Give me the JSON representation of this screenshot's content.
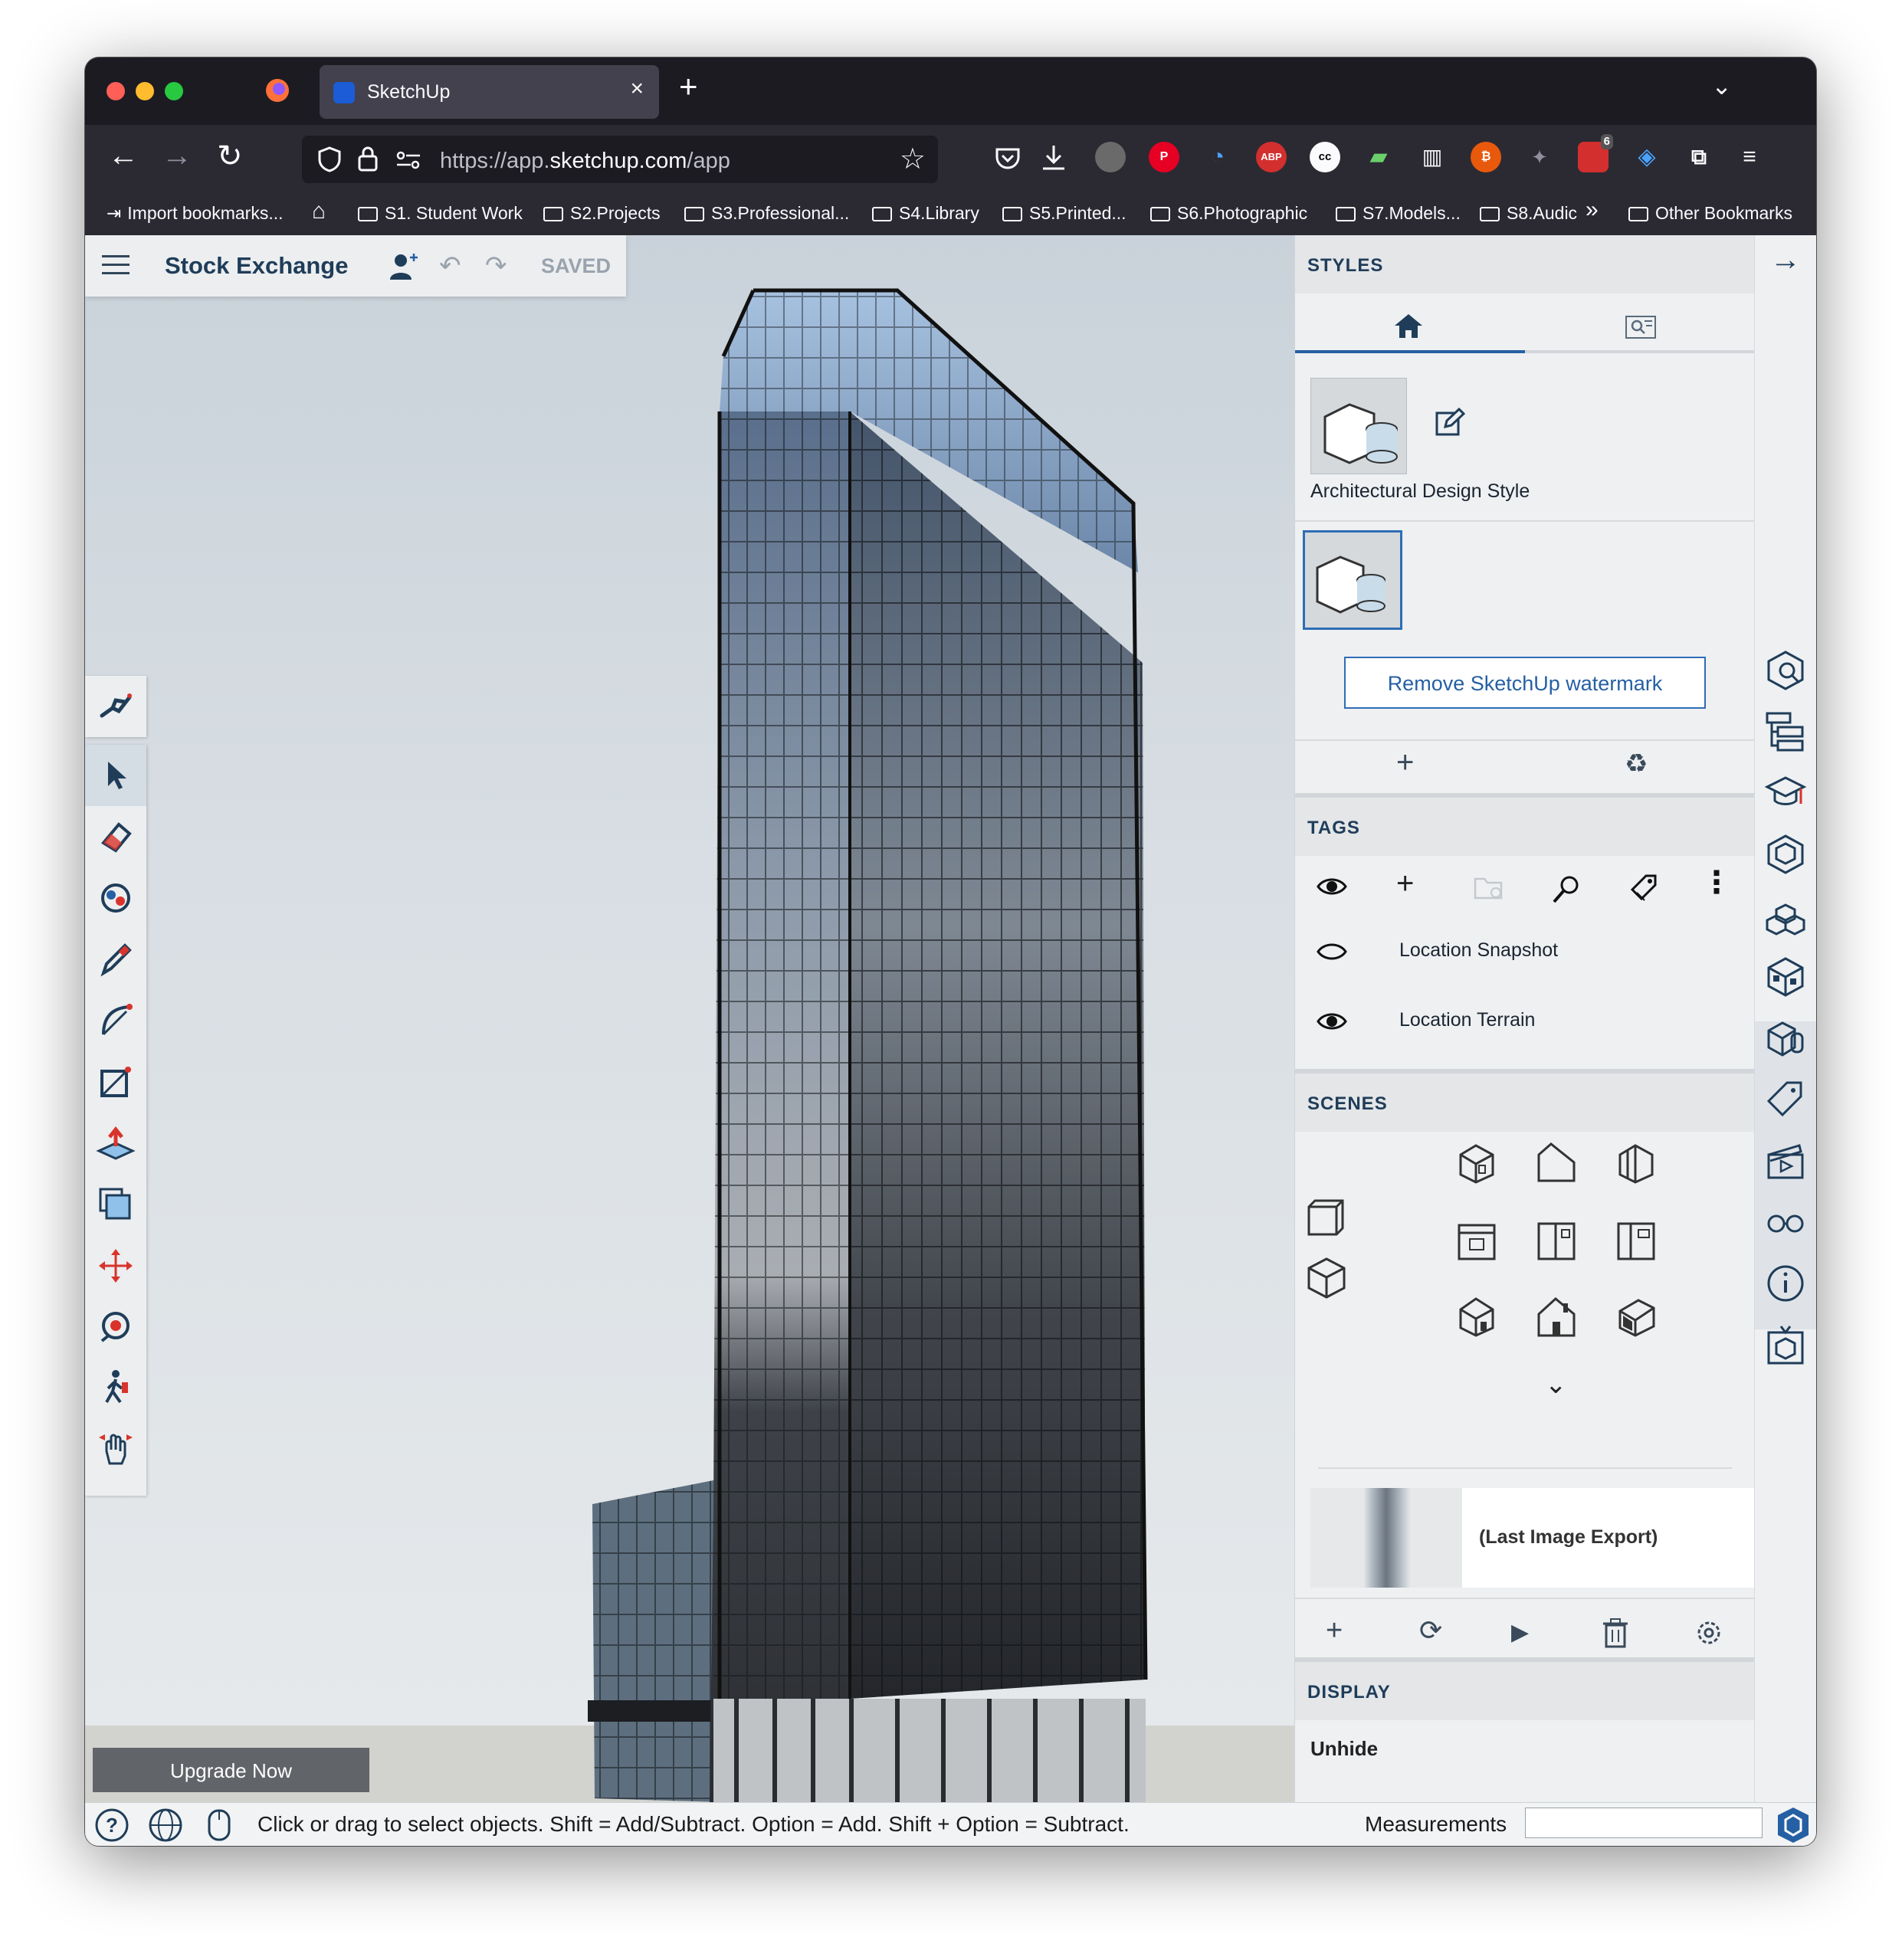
{
  "browser": {
    "tab_title": "SketchUp",
    "tab_close": "×",
    "new_tab": "+",
    "tab_list": "⌄",
    "url_prefix": "https://app.",
    "url_domain": "sketchup.com",
    "url_path": "/app",
    "extension_badge": "6",
    "bookmarks": [
      "Import bookmarks...",
      "S1. Student Work",
      "S2.Projects",
      "S3.Professional...",
      "S4.Library",
      "S5.Printed...",
      "S6.Photographic",
      "S7.Models...",
      "S8.Audic",
      "Other Bookmarks"
    ],
    "bookmarks_overflow": "»"
  },
  "app": {
    "project_name": "Stock Exchange",
    "save_status": "SAVED",
    "upgrade_label": "Upgrade Now",
    "status_message": "Click or drag to select objects. Shift = Add/Subtract. Option = Add. Shift + Option = Subtract.",
    "measurements_label": "Measurements",
    "measurements_value": ""
  },
  "panel": {
    "styles": {
      "heading": "STYLES",
      "style_name": "Architectural Design Style",
      "watermark_button": "Remove SketchUp watermark",
      "add_glyph": "+",
      "recycle_glyph": "♻"
    },
    "tags": {
      "heading": "TAGS",
      "add_glyph": "+",
      "more_glyph": "⋮",
      "items": [
        {
          "label": "Location Snapshot",
          "visible": false
        },
        {
          "label": "Location Terrain",
          "visible": true
        }
      ]
    },
    "scenes": {
      "heading": "SCENES",
      "expand_glyph": "⌄",
      "last_export_label": "(Last Image Export)",
      "add_glyph": "+",
      "update_glyph": "⟳",
      "play_glyph": "▶"
    },
    "display": {
      "heading": "DISPLAY",
      "first_item": "Unhide"
    }
  },
  "colors": {
    "accent": "#2660a4",
    "title_text": "#1f3d59",
    "browser_dark": "#1c1b22",
    "toolbar_bg": "#eceef0"
  }
}
